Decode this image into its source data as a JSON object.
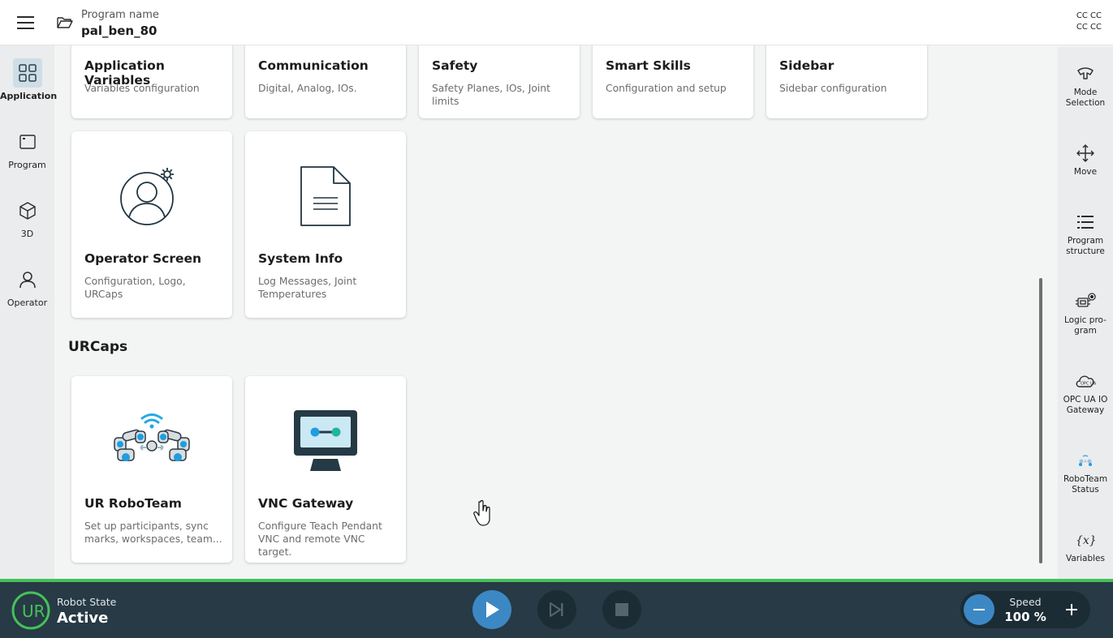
{
  "header": {
    "program_label": "Program name",
    "program_name": "pal_ben_80",
    "cc_line1": "CC CC",
    "cc_line2": "CC CC"
  },
  "left_nav": [
    {
      "label": "Application",
      "icon": "grid-icon",
      "active": true
    },
    {
      "label": "Program",
      "icon": "program-window-icon"
    },
    {
      "label": "3D",
      "icon": "cube-icon"
    },
    {
      "label": "Operator",
      "icon": "person-icon"
    }
  ],
  "right_nav": [
    {
      "label": "Mode Selection",
      "icon": "mode-selection-icon"
    },
    {
      "label": "Move",
      "icon": "move-arrows-icon"
    },
    {
      "label": "Program structure",
      "icon": "list-icon"
    },
    {
      "label": "Logic pro-gram",
      "icon": "logic-program-icon"
    },
    {
      "label": "OPC UA IO Gateway",
      "icon": "opc-ua-cloud-icon"
    },
    {
      "label": "RoboTeam Status",
      "icon": "roboteam-status-icon"
    },
    {
      "label": "Variables",
      "icon": "variables-icon"
    }
  ],
  "cards_top": [
    {
      "title": "Application Variables",
      "desc": "Variables configuration"
    },
    {
      "title": "Communication",
      "desc": "Digital, Analog, IOs."
    },
    {
      "title": "Safety",
      "desc": "Safety Planes, IOs, Joint limits"
    },
    {
      "title": "Smart Skills",
      "desc": "Configuration and setup"
    },
    {
      "title": "Sidebar",
      "desc": "Sidebar configuration"
    }
  ],
  "cards_mid": [
    {
      "title": "Operator Screen",
      "desc": "Configuration, Logo, URCaps",
      "icon": "operator-settings-icon"
    },
    {
      "title": "System Info",
      "desc": "Log Messages, Joint Temperatures",
      "icon": "document-icon"
    }
  ],
  "urcaps": {
    "section_title": "URCaps",
    "cards": [
      {
        "title": "UR RoboTeam",
        "desc": "Set up participants, sync marks, workspaces, team...",
        "icon": "roboteam-arms-icon"
      },
      {
        "title": "VNC Gateway",
        "desc": "Configure Teach Pendant VNC and remote VNC target.",
        "icon": "vnc-monitor-icon"
      }
    ]
  },
  "bottom": {
    "robot_state_label": "Robot State",
    "robot_state_value": "Active",
    "speed_label": "Speed",
    "speed_value": "100 %",
    "colors": {
      "bar": "#273a45",
      "accent": "#3c88c5",
      "status": "#45c05a"
    }
  }
}
